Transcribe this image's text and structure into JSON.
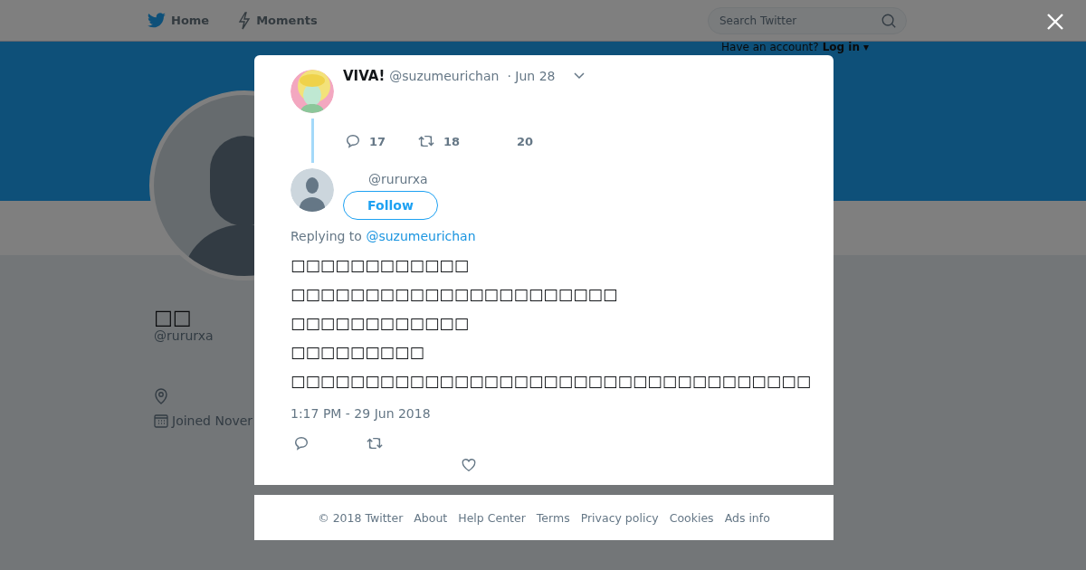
{
  "nav": {
    "items": [
      {
        "label": "Home",
        "kind": "bird"
      },
      {
        "label": "Moments",
        "kind": "bolt"
      }
    ],
    "search": {
      "placeholder": "Search Twitter"
    },
    "account_prompt": "Have an account?",
    "login": "Log in",
    "login_caret": "▾"
  },
  "profile": {
    "name": "□□",
    "handle": "@rururxa",
    "joined": "Joined Nover"
  },
  "modal": {
    "parent_tweet": {
      "name": "VIVA!",
      "handle": "@suzumeurichan",
      "date": "· Jun 28",
      "replies": "17",
      "retweets": "18",
      "likes": "20"
    },
    "tweet": {
      "handle": "@rururxa",
      "follow": "Follow",
      "replying_label": "Replying to",
      "replying_to": "@suzumeurichan",
      "text": "□□□□□□□□□□□□\n□□□□□□□□□□□□□□□□□□□□□□\n□□□□□□□□□□□□\n□□□□□□□□□\n□□□□□□□□□□□□□□□□□□□□□□□□□□□□□□□□□□□",
      "timestamp": "1:17 PM - 29 Jun 2018"
    }
  },
  "footer": [
    "© 2018 Twitter",
    "About",
    "Help Center",
    "Terms",
    "Privacy policy",
    "Cookies",
    "Ads info"
  ]
}
